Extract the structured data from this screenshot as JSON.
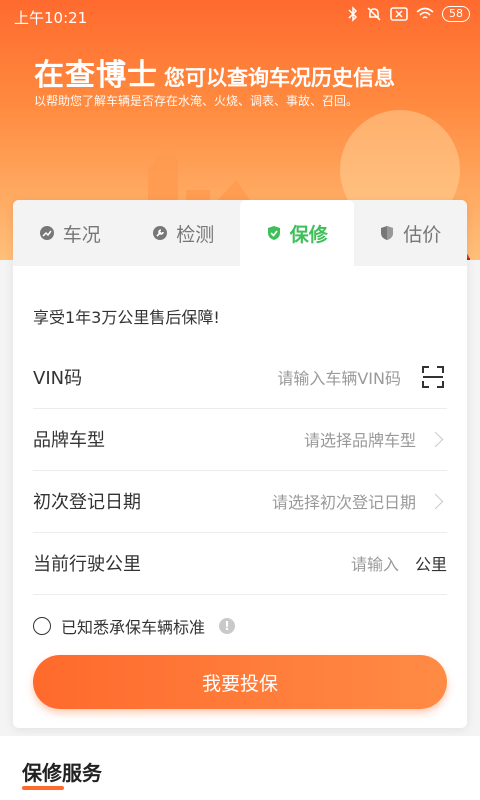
{
  "status_bar": {
    "time": "上午10:21",
    "battery": "58"
  },
  "hero": {
    "brand": "在查博士",
    "tagline": "您可以查询车况历史信息",
    "subline": "以帮助您了解车辆是否存在水淹、火烧、调表、事故、召回。"
  },
  "tabs": [
    {
      "label": "车况",
      "icon": "chart-icon",
      "active": false
    },
    {
      "label": "检测",
      "icon": "wrench-icon",
      "active": false
    },
    {
      "label": "保修",
      "icon": "shield-check-icon",
      "active": true
    },
    {
      "label": "估价",
      "icon": "shield-icon",
      "active": false
    }
  ],
  "form": {
    "promo": "享受1年3万公里售后保障!",
    "vin": {
      "label": "VIN码",
      "placeholder": "请输入车辆VIN码"
    },
    "brand_model": {
      "label": "品牌车型",
      "placeholder": "请选择品牌车型"
    },
    "reg_date": {
      "label": "初次登记日期",
      "placeholder": "请选择初次登记日期"
    },
    "mileage": {
      "label": "当前行驶公里",
      "placeholder": "请输入",
      "unit": "公里"
    },
    "agree_text": "已知悉承保车辆标准",
    "info_glyph": "!",
    "submit": "我要投保"
  },
  "section": {
    "title": "保修服务"
  },
  "colors": {
    "accent": "#ff6a2c",
    "active_tab": "#3fbf5a"
  }
}
